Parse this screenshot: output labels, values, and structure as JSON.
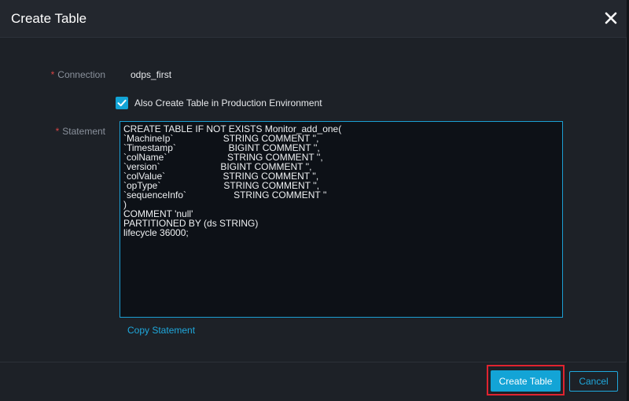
{
  "dialog": {
    "title": "Create Table"
  },
  "form": {
    "required_mark": "*",
    "connection_label": "Connection",
    "connection_value": "odps_first",
    "production_checkbox_label": "Also Create Table in Production Environment",
    "production_checkbox_checked": true,
    "statement_label": "Statement",
    "statement_text": "CREATE TABLE IF NOT EXISTS Monitor_add_one(\n`MachineIp`                   STRING COMMENT '',\n`Timestamp`                    BIGINT COMMENT '',\n`colName`                       STRING COMMENT '',\n`version`                       BIGINT COMMENT '',\n`colValue`                      STRING COMMENT '',\n`opType`                        STRING COMMENT '',\n`sequenceInfo`                  STRING COMMENT ''\n)\nCOMMENT 'null'\nPARTITIONED BY (ds STRING)\nlifecycle 36000;",
    "copy_statement_label": "Copy Statement"
  },
  "footer": {
    "create_button_label": "Create Table",
    "cancel_button_label": "Cancel"
  },
  "icons": {
    "close": "close-icon",
    "checkmark": "checkmark-icon"
  },
  "colors": {
    "accent": "#13a4d6",
    "background": "#1d2127",
    "editor_background": "#0d1117",
    "required": "#d64545",
    "highlight": "#e0232f"
  }
}
